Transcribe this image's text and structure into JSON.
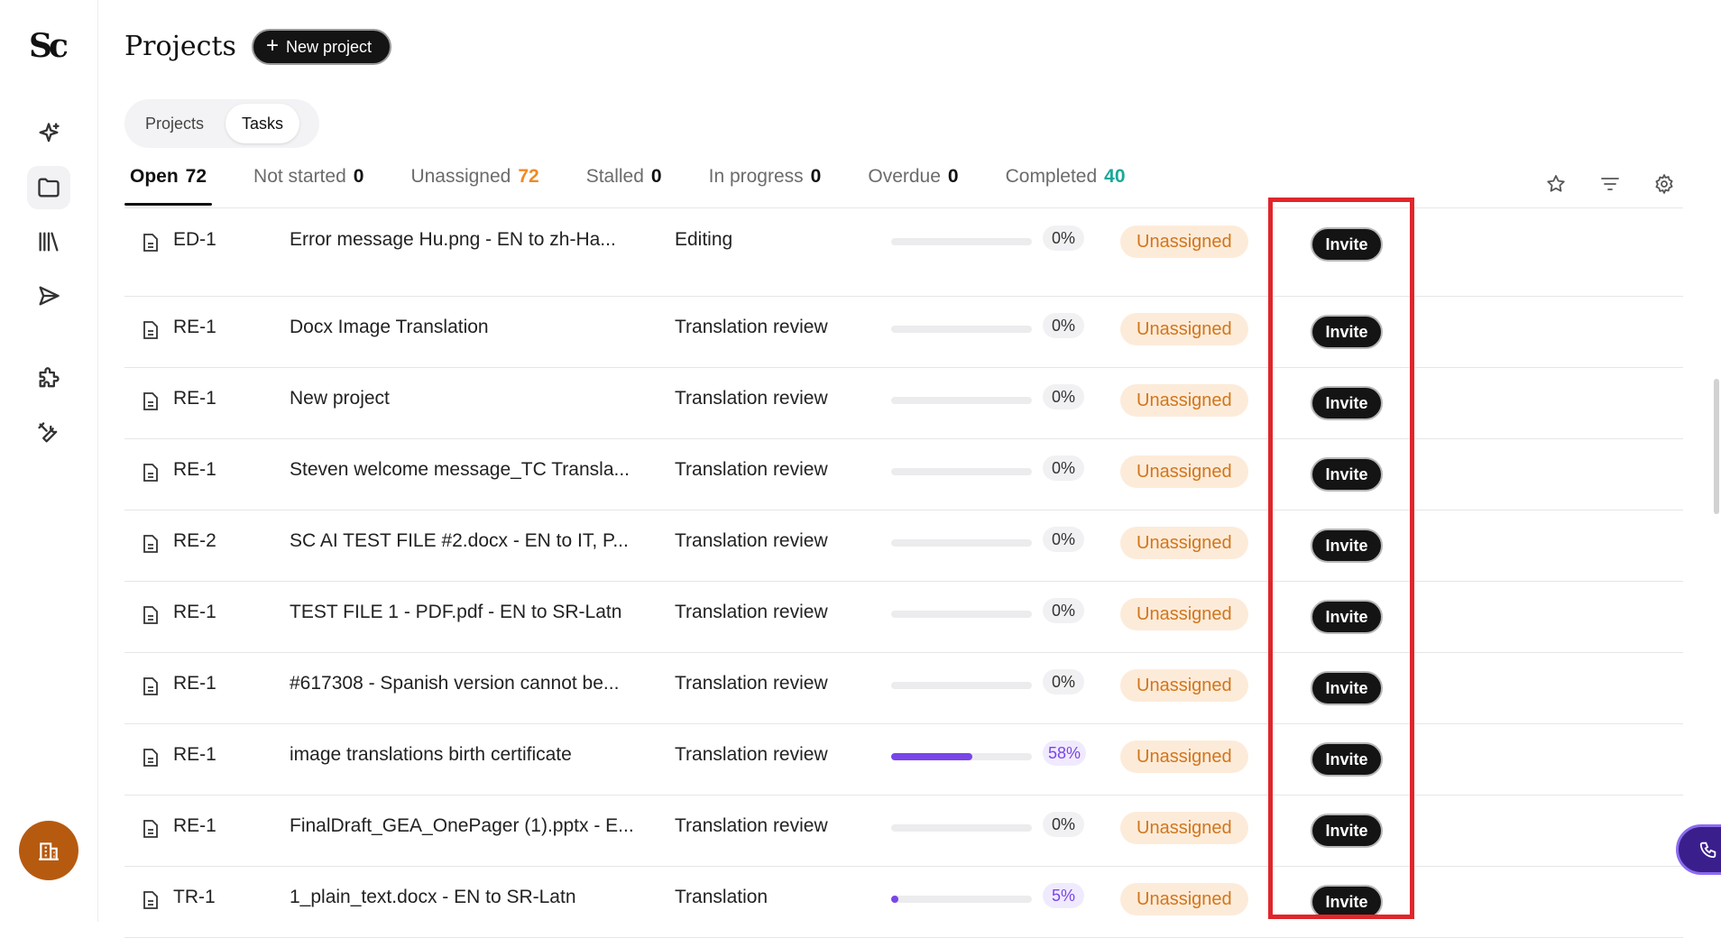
{
  "header": {
    "title": "Projects",
    "new_project_label": "New project"
  },
  "view_switch": {
    "options": [
      "Projects",
      "Tasks"
    ],
    "selected": "Tasks"
  },
  "tabs": [
    {
      "label": "Open",
      "count": "72"
    },
    {
      "label": "Not started",
      "count": "0"
    },
    {
      "label": "Unassigned",
      "count": "72"
    },
    {
      "label": "Stalled",
      "count": "0"
    },
    {
      "label": "In progress",
      "count": "0"
    },
    {
      "label": "Overdue",
      "count": "0"
    },
    {
      "label": "Completed",
      "count": "40"
    }
  ],
  "toolbar_icons": [
    "star-icon",
    "filter-icon",
    "settings-gear-icon"
  ],
  "sidebar_icons": [
    "sparkle-icon",
    "folder-icon",
    "library-icon",
    "send-icon",
    "puzzle-icon",
    "tools-icon",
    "building-icon"
  ],
  "colors": {
    "accent": "#7a45e8",
    "unassigned_text": "#d0761c",
    "unassigned_bg": "#fdebd9",
    "highlight": "#e0262b",
    "org_button": "#b65a10"
  },
  "tasks": [
    {
      "id": "ED-1",
      "name": "Error message Hu.png - EN to zh-Ha...",
      "stage": "Editing",
      "progress_label": "0%",
      "progress": 0,
      "status": "Unassigned",
      "action": "Invite"
    },
    {
      "id": "RE-1",
      "name": "Docx Image Translation",
      "stage": "Translation review",
      "progress_label": "0%",
      "progress": 0,
      "status": "Unassigned",
      "action": "Invite"
    },
    {
      "id": "RE-1",
      "name": "New project",
      "stage": "Translation review",
      "progress_label": "0%",
      "progress": 0,
      "status": "Unassigned",
      "action": "Invite"
    },
    {
      "id": "RE-1",
      "name": "Steven welcome message_TC Transla...",
      "stage": "Translation review",
      "progress_label": "0%",
      "progress": 0,
      "status": "Unassigned",
      "action": "Invite"
    },
    {
      "id": "RE-2",
      "name": "SC AI TEST FILE #2.docx - EN to IT, P...",
      "stage": "Translation review",
      "progress_label": "0%",
      "progress": 0,
      "status": "Unassigned",
      "action": "Invite"
    },
    {
      "id": "RE-1",
      "name": "TEST FILE 1 - PDF.pdf - EN to SR-Latn",
      "stage": "Translation review",
      "progress_label": "0%",
      "progress": 0,
      "status": "Unassigned",
      "action": "Invite"
    },
    {
      "id": "RE-1",
      "name": "#617308 - Spanish version cannot be...",
      "stage": "Translation review",
      "progress_label": "0%",
      "progress": 0,
      "status": "Unassigned",
      "action": "Invite"
    },
    {
      "id": "RE-1",
      "name": "image translations birth certificate",
      "stage": "Translation review",
      "progress_label": "58%",
      "progress": 58,
      "status": "Unassigned",
      "action": "Invite"
    },
    {
      "id": "RE-1",
      "name": "FinalDraft_GEA_OnePager (1).pptx - E...",
      "stage": "Translation review",
      "progress_label": "0%",
      "progress": 0,
      "status": "Unassigned",
      "action": "Invite"
    },
    {
      "id": "TR-1",
      "name": "1_plain_text.docx - EN to SR-Latn",
      "stage": "Translation",
      "progress_label": "5%",
      "progress": 5,
      "status": "Unassigned",
      "action": "Invite"
    }
  ]
}
